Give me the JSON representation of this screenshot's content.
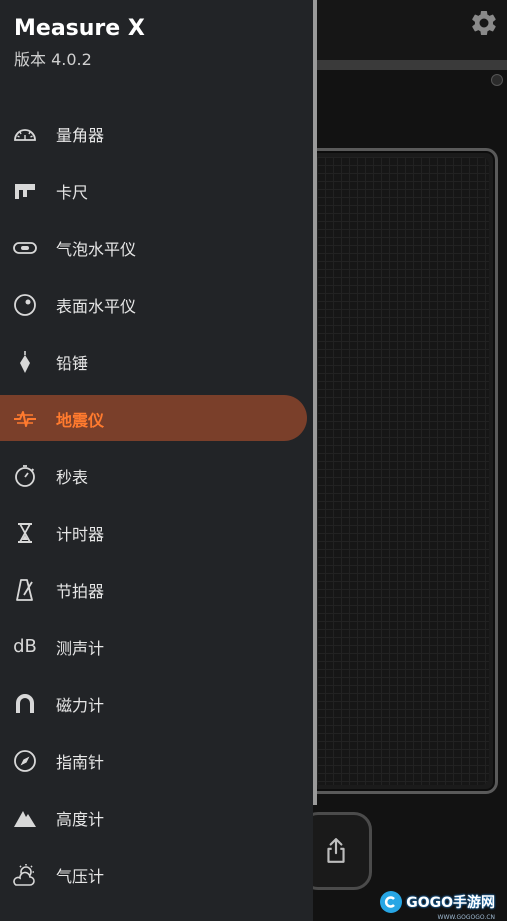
{
  "drawer": {
    "title": "Measure X",
    "version": "版本 4.0.2",
    "items": [
      {
        "label": "量角器",
        "icon": "protractor-icon"
      },
      {
        "label": "卡尺",
        "icon": "caliper-icon"
      },
      {
        "label": "气泡水平仪",
        "icon": "bubble-level-icon"
      },
      {
        "label": "表面水平仪",
        "icon": "surface-level-icon"
      },
      {
        "label": "铅锤",
        "icon": "plumb-bob-icon"
      },
      {
        "label": "地震仪",
        "icon": "seismograph-icon",
        "active": true
      },
      {
        "label": "秒表",
        "icon": "stopwatch-icon"
      },
      {
        "label": "计时器",
        "icon": "hourglass-icon"
      },
      {
        "label": "节拍器",
        "icon": "metronome-icon"
      },
      {
        "label": "测声计",
        "icon": "decibel-icon",
        "icon_text": "dB"
      },
      {
        "label": "磁力计",
        "icon": "magnet-icon"
      },
      {
        "label": "指南针",
        "icon": "compass-icon"
      },
      {
        "label": "高度计",
        "icon": "altitude-icon"
      },
      {
        "label": "气压计",
        "icon": "barometer-icon"
      }
    ]
  },
  "watermark": {
    "text": "GOGO手游网",
    "sub": "WWW.GOGOGO.CN"
  },
  "colors": {
    "accent": "#ff7a2e",
    "active_bg": "#7a3f2a",
    "drawer_bg": "#222427"
  }
}
